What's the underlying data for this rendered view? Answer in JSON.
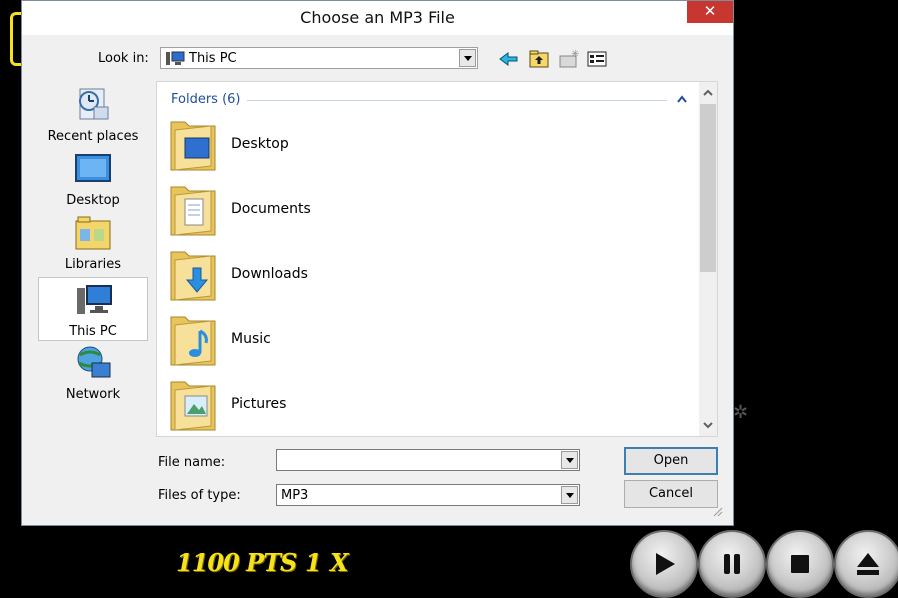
{
  "dialog": {
    "title": "Choose an MP3 File",
    "close_glyph": "✕",
    "look_in_label": "Look in:",
    "look_in_value": "This PC",
    "toolbar": {
      "back_icon": "back-arrow-icon",
      "up_icon": "up-folder-icon",
      "new_folder_icon": "new-folder-icon",
      "view_icon": "view-menu-icon"
    },
    "places": [
      {
        "label": "Recent places",
        "icon": "recent-places-icon"
      },
      {
        "label": "Desktop",
        "icon": "desktop-icon"
      },
      {
        "label": "Libraries",
        "icon": "libraries-icon"
      },
      {
        "label": "This PC",
        "icon": "this-pc-icon",
        "selected": true
      },
      {
        "label": "Network",
        "icon": "network-icon"
      }
    ],
    "group_header": "Folders (6)",
    "items": [
      {
        "name": "Desktop",
        "icon": "desktop-folder-icon"
      },
      {
        "name": "Documents",
        "icon": "documents-folder-icon"
      },
      {
        "name": "Downloads",
        "icon": "downloads-folder-icon"
      },
      {
        "name": "Music",
        "icon": "music-folder-icon"
      },
      {
        "name": "Pictures",
        "icon": "pictures-folder-icon"
      }
    ],
    "file_name_label": "File name:",
    "file_name_value": "",
    "file_type_label": "Files of type:",
    "file_type_value": "MP3",
    "open_label": "Open",
    "cancel_label": "Cancel"
  },
  "game": {
    "score": "1100 PTS",
    "multiplier": "1 X",
    "accent": "#f6e21a",
    "controls": [
      "play-icon",
      "pause-icon",
      "stop-icon",
      "eject-icon"
    ]
  }
}
